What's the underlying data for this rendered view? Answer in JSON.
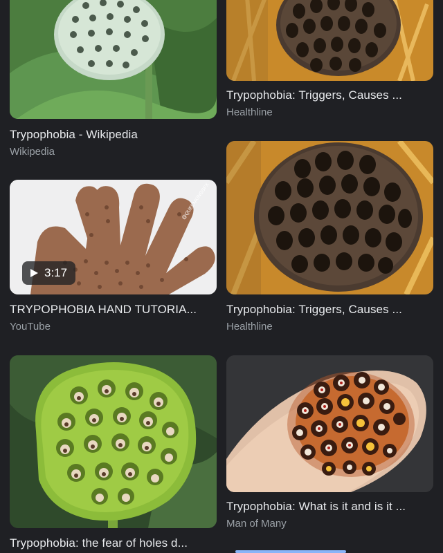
{
  "results": [
    {
      "title": "Trypophobia - Wikipedia",
      "source": "Wikipedia",
      "image": "green-lotus-seed-pod-image"
    },
    {
      "title": "Trypophobia: Triggers, Causes ...",
      "source": "Healthline",
      "image": "brown-lotus-seed-pod-image"
    },
    {
      "title": "TRYPOPHOBIA HAND TUTORIA...",
      "source": "YouTube",
      "image": "hand-with-holes-image",
      "video_duration": "3:17",
      "watermark": "@QUEENKINGSFX"
    },
    {
      "title": "Trypophobia: Triggers, Causes ...",
      "source": "Healthline",
      "image": "brown-lotus-seed-pod-image"
    },
    {
      "title": "Trypophobia: the fear of holes d...",
      "source": "",
      "image": "green-lotus-pod-with-seeds-image"
    },
    {
      "title": "Trypophobia: What is it and is it ...",
      "source": "Man of Many",
      "image": "fingertip-with-holes-image"
    }
  ],
  "colors": {
    "background": "#1f2024",
    "title": "#e8eaed",
    "source": "#9aa0a6",
    "accent": "#8ab4f8"
  }
}
